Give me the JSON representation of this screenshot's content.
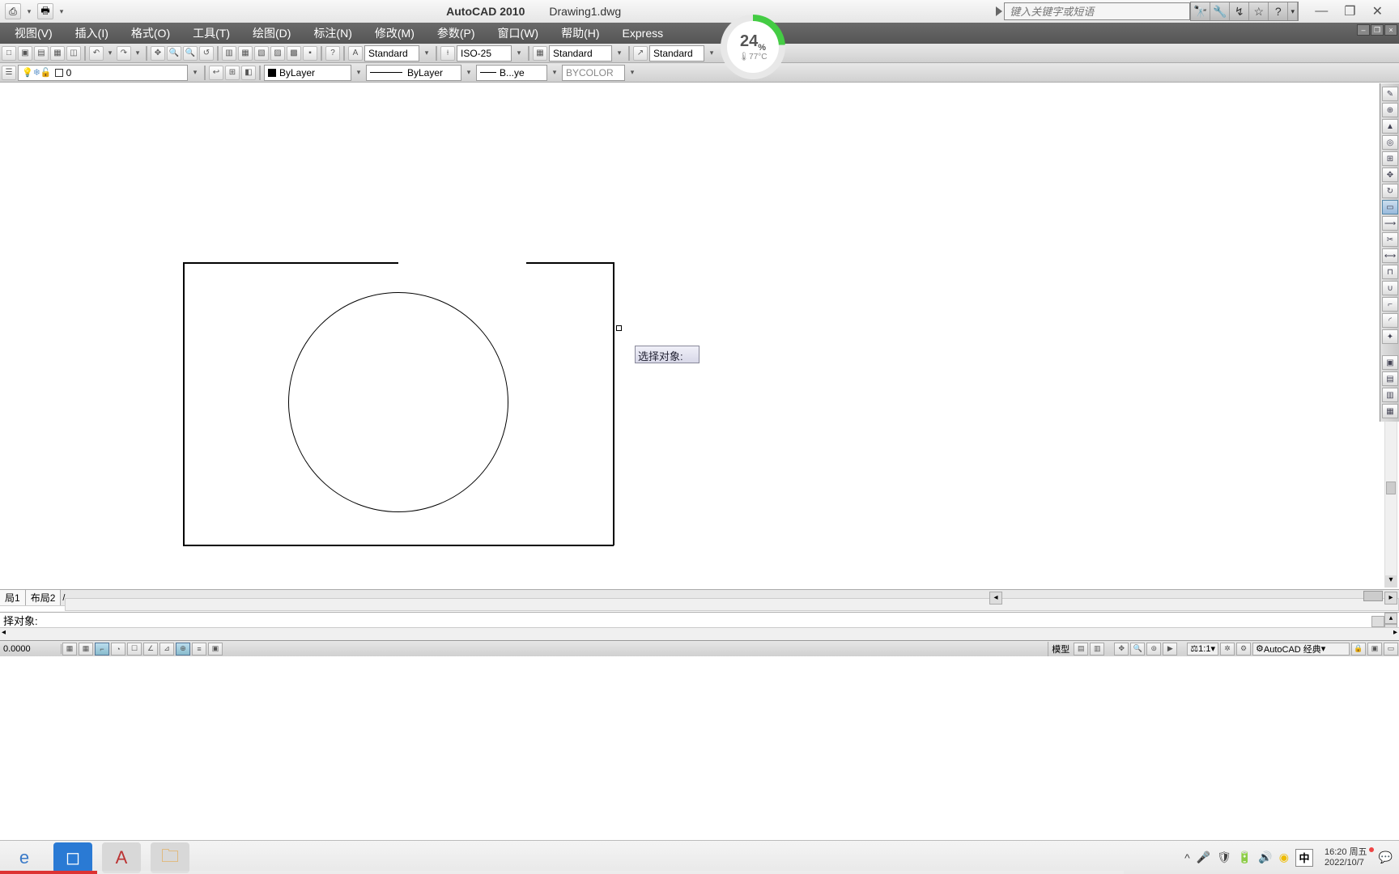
{
  "titlebar": {
    "app_name": "AutoCAD 2010",
    "doc_name": "Drawing1.dwg",
    "search_placeholder": "键入关键字或短语",
    "win_min": "—",
    "win_max": "❐",
    "win_close": "✕"
  },
  "menubar": {
    "items": [
      "视图(V)",
      "插入(I)",
      "格式(O)",
      "工具(T)",
      "绘图(D)",
      "标注(N)",
      "修改(M)",
      "参数(P)",
      "窗口(W)",
      "帮助(H)",
      "Express"
    ]
  },
  "toolbar1": {
    "text_style": "Standard",
    "dim_style": "ISO-25",
    "table_style": "Standard",
    "mleader_style": "Standard"
  },
  "toolbar2": {
    "layer_value": "0",
    "color_value": "ByLayer",
    "linetype_value": "ByLayer",
    "lineweight_value": "B...ye",
    "plot_style": "BYCOLOR"
  },
  "canvas": {
    "tooltip_text": "选择对象:"
  },
  "layout_tabs": {
    "tab1": "局1",
    "tab2": "布局2"
  },
  "command": {
    "history_line": "择对象:",
    "coord": "0.0000"
  },
  "statusbar": {
    "model_label": "模型",
    "scale": "1:1",
    "workspace": "AutoCAD 经典"
  },
  "gauge": {
    "percent": "24",
    "pct_sign": "%",
    "temp": "77°C"
  },
  "taskbar": {
    "ime": "中",
    "time": "16:20",
    "dow": "周五",
    "date": "2022/10/7"
  }
}
